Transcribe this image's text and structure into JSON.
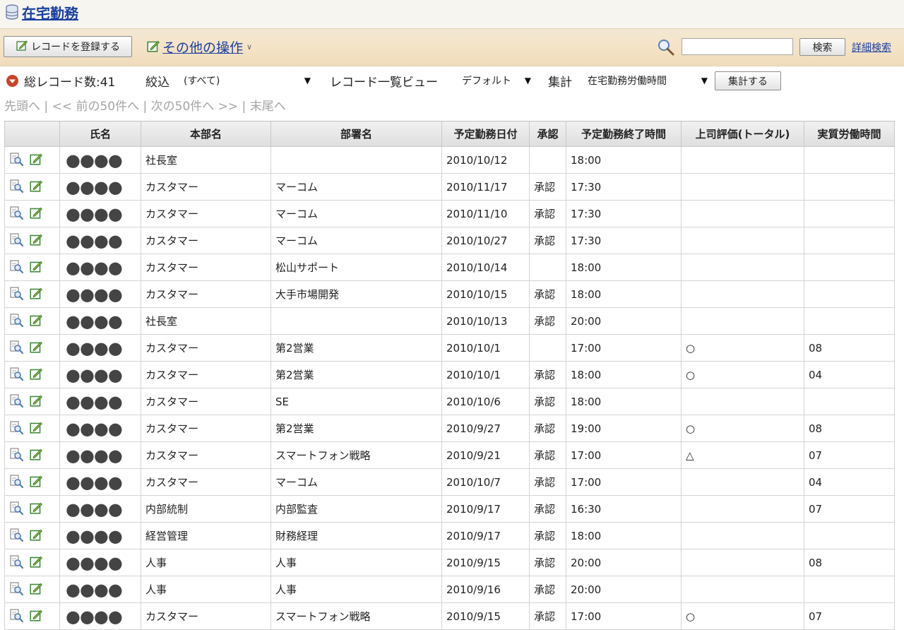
{
  "app": {
    "title": "在宅勤務"
  },
  "toolbar": {
    "register_label": "レコードを登録する",
    "other_ops_label": "その他の操作",
    "search_placeholder": "",
    "search_label": "検索",
    "advanced_search_label": "詳細検索"
  },
  "filter": {
    "total_label": "総レコード数:41",
    "narrow_label": "絞込",
    "narrow_value": "(すべて)",
    "view_label": "レコード一覧ビュー",
    "view_value": "デフォルト",
    "aggregate_label": "集計",
    "aggregate_value": "在宅勤務労働時間",
    "aggregate_button": "集計する"
  },
  "pager": {
    "first": "先頭へ",
    "sep1": " | ",
    "prev": "<< 前の50件へ",
    "sep2": " | ",
    "next": "次の50件へ >>",
    "sep3": " | ",
    "last": "末尾へ"
  },
  "table": {
    "columns": [
      "",
      "氏名",
      "本部名",
      "部署名",
      "予定勤務日付",
      "承認",
      "予定勤務終了時間",
      "上司評価(トータル)",
      "実質労働時間"
    ],
    "rows": [
      [
        "●●●●",
        "社長室",
        "",
        "2010/10/12",
        "",
        "18:00",
        "",
        ""
      ],
      [
        "●●●●",
        "カスタマー",
        "マーコム",
        "2010/11/17",
        "承認",
        "17:30",
        "",
        ""
      ],
      [
        "●●●●",
        "カスタマー",
        "マーコム",
        "2010/11/10",
        "承認",
        "17:30",
        "",
        ""
      ],
      [
        "●●●●",
        "カスタマー",
        "マーコム",
        "2010/10/27",
        "承認",
        "17:30",
        "",
        ""
      ],
      [
        "●●●●",
        "カスタマー",
        "松山サポート",
        "2010/10/14",
        "",
        "18:00",
        "",
        ""
      ],
      [
        "●●●●",
        "カスタマー",
        "大手市場開発",
        "2010/10/15",
        "承認",
        "18:00",
        "",
        ""
      ],
      [
        "●●●●",
        "社長室",
        "",
        "2010/10/13",
        "承認",
        "20:00",
        "",
        ""
      ],
      [
        "●●●●",
        "カスタマー",
        "第2営業",
        "2010/10/1",
        "",
        "17:00",
        "○",
        "08"
      ],
      [
        "●●●●",
        "カスタマー",
        "第2営業",
        "2010/10/1",
        "承認",
        "18:00",
        "○",
        "04"
      ],
      [
        "●●●●",
        "カスタマー",
        "SE",
        "2010/10/6",
        "承認",
        "18:00",
        "",
        ""
      ],
      [
        "●●●●",
        "カスタマー",
        "第2営業",
        "2010/9/27",
        "承認",
        "19:00",
        "○",
        "08"
      ],
      [
        "●●●●",
        "カスタマー",
        "スマートフォン戦略",
        "2010/9/21",
        "承認",
        "17:00",
        "△",
        "07"
      ],
      [
        "●●●●",
        "カスタマー",
        "マーコム",
        "2010/10/7",
        "承認",
        "17:00",
        "",
        "04"
      ],
      [
        "●●●●",
        "内部統制",
        "内部監査",
        "2010/9/17",
        "承認",
        "16:30",
        "",
        "07"
      ],
      [
        "●●●●",
        "経営管理",
        "財務経理",
        "2010/9/17",
        "承認",
        "18:00",
        "",
        ""
      ],
      [
        "●●●●",
        "人事",
        "人事",
        "2010/9/15",
        "承認",
        "20:00",
        "",
        "08"
      ],
      [
        "●●●●",
        "人事",
        "人事",
        "2010/9/16",
        "承認",
        "20:00",
        "",
        ""
      ],
      [
        "●●●●",
        "カスタマー",
        "スマートフォン戦略",
        "2010/9/15",
        "承認",
        "17:00",
        "○",
        "07"
      ]
    ]
  },
  "colors": {
    "link": "#1a3fa0",
    "toolbar_bg": "#f5e3c6",
    "title_bg": "#f6f5ef",
    "pager_text": "#a5a5a5",
    "down_circle": "#c8442a"
  },
  "icons": {
    "app": "database-icon",
    "edit": "edit-pencil-icon",
    "view": "view-magnifier-icon",
    "search": "search-icon",
    "total": "down-circle-icon"
  }
}
